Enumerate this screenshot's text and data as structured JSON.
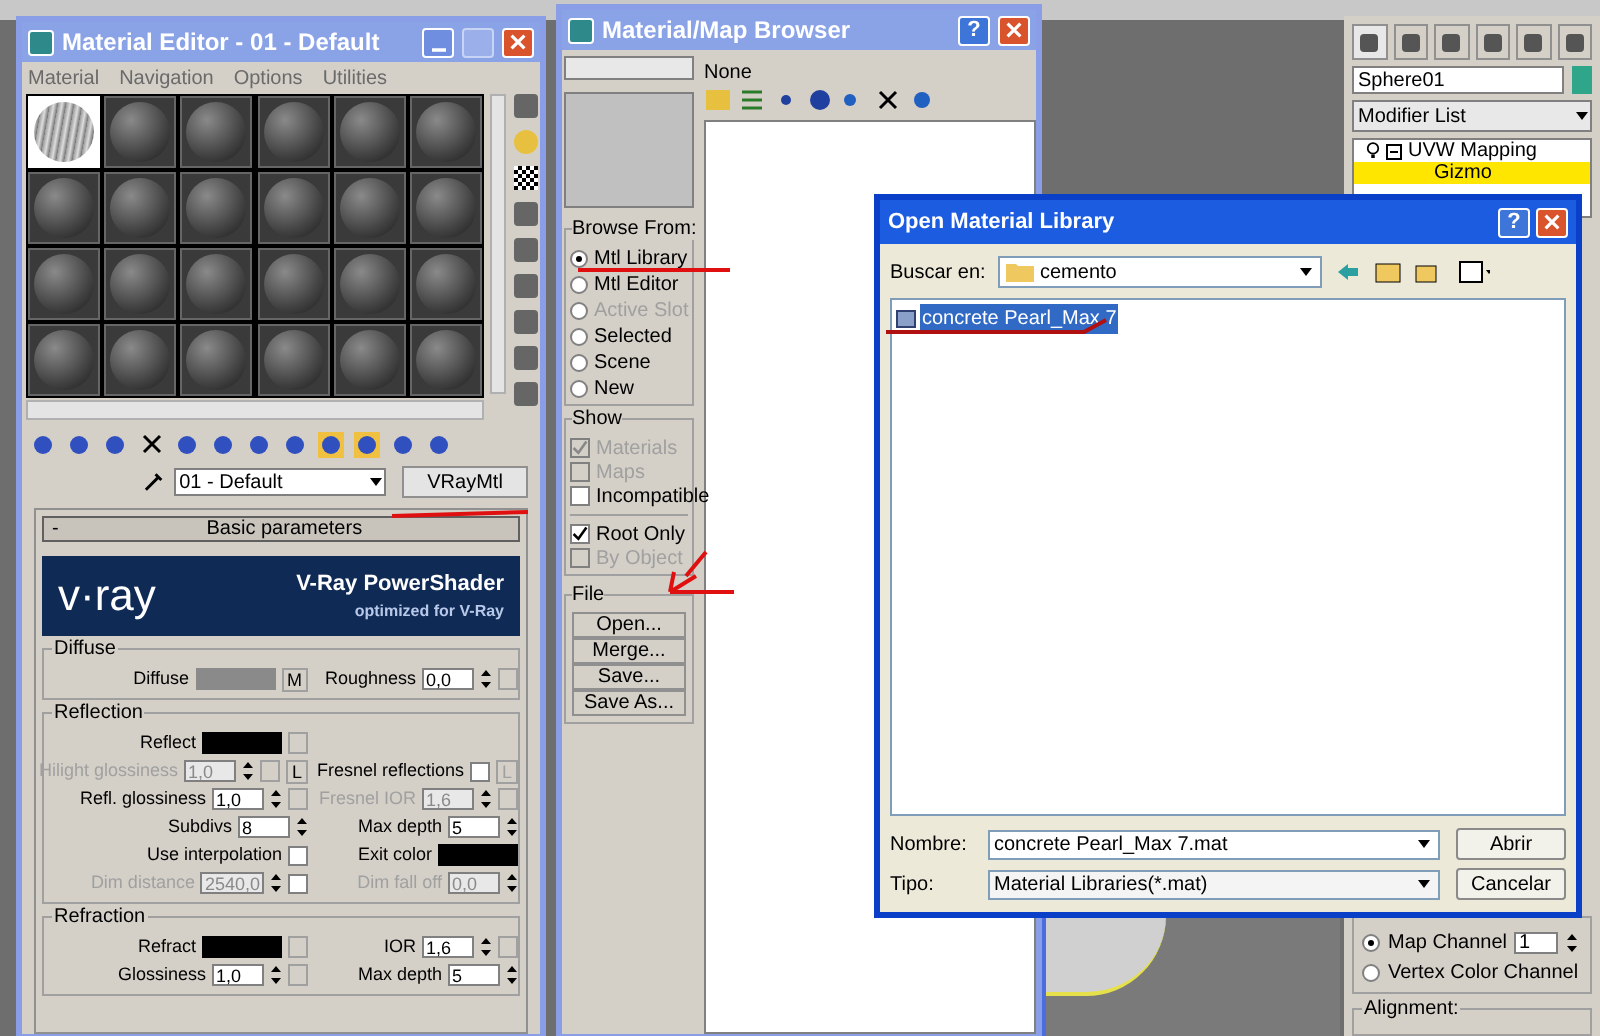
{
  "material_editor": {
    "title": "Material Editor - 01 - Default",
    "menu": [
      "Material",
      "Navigation",
      "Options",
      "Utilities"
    ],
    "slots": [
      {
        "selected": true
      },
      {
        "selected": false
      },
      {
        "selected": false
      },
      {
        "selected": false
      },
      {
        "selected": false
      },
      {
        "selected": false
      },
      {
        "selected": false
      },
      {
        "selected": false
      },
      {
        "selected": false
      },
      {
        "selected": false
      },
      {
        "selected": false
      },
      {
        "selected": false
      },
      {
        "selected": false
      },
      {
        "selected": false
      },
      {
        "selected": false
      },
      {
        "selected": false
      },
      {
        "selected": false
      },
      {
        "selected": false
      },
      {
        "selected": false
      },
      {
        "selected": false
      },
      {
        "selected": false
      },
      {
        "selected": false
      },
      {
        "selected": false
      },
      {
        "selected": false
      }
    ],
    "material_name": "01 - Default",
    "material_type": "VRayMtl",
    "rollout": {
      "collapse_sign": "-",
      "title": "Basic parameters"
    },
    "banner": {
      "logo": "v·ray",
      "title": "V-Ray PowerShader",
      "subtitle": "optimized for V-Ray"
    },
    "groups": [
      {
        "title": "Diffuse",
        "rows": [
          {
            "left": {
              "kind": "color",
              "label": "Diffuse",
              "color": "#8a8a8a",
              "tag": "M",
              "disabled": false
            },
            "right": {
              "kind": "spinner",
              "label": "Roughness",
              "value": "0,0",
              "map_slot": true,
              "disabled": false
            }
          }
        ]
      },
      {
        "title": "Reflection",
        "rows": [
          {
            "left": {
              "kind": "color",
              "label": "Reflect",
              "color": "#000000",
              "map_slot": true,
              "disabled": false
            }
          },
          {
            "left": {
              "kind": "spinner",
              "label": "Hilight glossiness",
              "value": "1,0",
              "map_slot": true,
              "tag": "L",
              "disabled": true
            },
            "right": {
              "kind": "checkbox",
              "label": "Fresnel reflections",
              "checked": false,
              "tag": "L",
              "tag_disabled": true,
              "disabled": false
            }
          },
          {
            "left": {
              "kind": "spinner",
              "label": "Refl. glossiness",
              "value": "1,0",
              "map_slot": true,
              "disabled": false
            },
            "right": {
              "kind": "spinner",
              "label": "Fresnel IOR",
              "value": "1,6",
              "map_slot": true,
              "disabled": true
            }
          },
          {
            "left": {
              "kind": "spinner",
              "label": "Subdivs",
              "value": "8",
              "disabled": false
            },
            "right": {
              "kind": "spinner",
              "label": "Max depth",
              "value": "5",
              "disabled": false
            }
          },
          {
            "left": {
              "kind": "checkbox",
              "label": "Use interpolation",
              "checked": false,
              "disabled": false
            },
            "right": {
              "kind": "color",
              "label": "Exit color",
              "color": "#000000",
              "disabled": false
            }
          },
          {
            "left": {
              "kind": "spinner",
              "label": "Dim distance",
              "value": "2540,0",
              "toggle_checked": false,
              "disabled": true
            },
            "right": {
              "kind": "spinner",
              "label": "Dim fall off",
              "value": "0,0",
              "disabled": true
            }
          }
        ]
      },
      {
        "title": "Refraction",
        "rows": [
          {
            "left": {
              "kind": "color",
              "label": "Refract",
              "color": "#000000",
              "map_slot": true,
              "disabled": false
            },
            "right": {
              "kind": "spinner",
              "label": "IOR",
              "value": "1,6",
              "map_slot": true,
              "disabled": false
            }
          },
          {
            "left": {
              "kind": "spinner",
              "label": "Glossiness",
              "value": "1,0",
              "map_slot": true,
              "disabled": false
            },
            "right": {
              "kind": "spinner",
              "label": "Max depth",
              "value": "5",
              "disabled": false
            }
          }
        ]
      }
    ]
  },
  "browser": {
    "title": "Material/Map Browser",
    "help_button": "?",
    "current": "None",
    "browse_from": {
      "title": "Browse From:",
      "options": [
        {
          "label": "Mtl Library",
          "selected": true,
          "disabled": false
        },
        {
          "label": "Mtl Editor",
          "selected": false,
          "disabled": false
        },
        {
          "label": "Active Slot",
          "selected": false,
          "disabled": true
        },
        {
          "label": "Selected",
          "selected": false,
          "disabled": false
        },
        {
          "label": "Scene",
          "selected": false,
          "disabled": false
        },
        {
          "label": "New",
          "selected": false,
          "disabled": false
        }
      ]
    },
    "show": {
      "title": "Show",
      "options": [
        {
          "label": "Materials",
          "checked": true,
          "disabled": true
        },
        {
          "label": "Maps",
          "checked": false,
          "disabled": true
        },
        {
          "label": "Incompatible",
          "checked": false,
          "disabled": false
        }
      ],
      "options_2": [
        {
          "label": "Root Only",
          "checked": true,
          "disabled": false
        },
        {
          "label": "By Object",
          "checked": false,
          "disabled": true
        }
      ]
    },
    "file": {
      "title": "File",
      "buttons": [
        "Open...",
        "Merge...",
        "Save...",
        "Save As..."
      ]
    }
  },
  "dialog": {
    "title": "Open Material Library",
    "help_button": "?",
    "look_in_label": "Buscar en:",
    "folder": "cemento",
    "files": [
      {
        "name": "concrete Pearl_Max 7",
        "selected": true
      }
    ],
    "name_label": "Nombre:",
    "name_value": "concrete Pearl_Max 7.mat",
    "type_label": "Tipo:",
    "type_value": "Material Libraries(*.mat)",
    "buttons": [
      "Abrir",
      "Cancelar"
    ]
  },
  "command_panel": {
    "object_name": "Sphere01",
    "modifier_list": "Modifier List",
    "stack": [
      {
        "label": "UVW Mapping",
        "expanded": true,
        "children": [
          {
            "label": "Gizmo",
            "selected": true
          }
        ]
      }
    ],
    "channel": {
      "options": [
        {
          "label": "Map Channel",
          "selected": true,
          "value": "1"
        },
        {
          "label": "Vertex Color Channel",
          "selected": false
        }
      ]
    },
    "alignment": {
      "title": "Alignment:"
    }
  }
}
